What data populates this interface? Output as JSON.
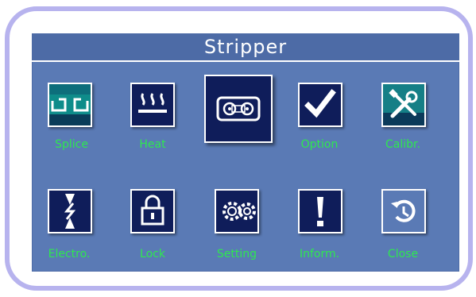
{
  "dialog": {
    "title": "Stripper"
  },
  "buttons": {
    "splice": "Splice",
    "heat": "Heat",
    "option": "Option",
    "calibrate": "Calibr.",
    "electro": "Electro.",
    "lock": "Lock",
    "setting": "Setting",
    "inform": "Inform.",
    "close": "Close"
  },
  "colors": {
    "frame": "#b7b3ee",
    "panel": "#5a7ab5",
    "title_bar": "#4d6ba6",
    "label": "#2ee84f",
    "tile_dark": "#0f1d5a"
  },
  "icons": {
    "splice": "splice-icon",
    "heat": "heat-icon",
    "stripper": "stripper-icon",
    "option": "checkmark-icon",
    "calibrate": "tools-icon",
    "electro": "electrode-icon",
    "lock": "lock-icon",
    "setting": "gears-icon",
    "inform": "exclamation-icon",
    "close": "undo-icon"
  }
}
